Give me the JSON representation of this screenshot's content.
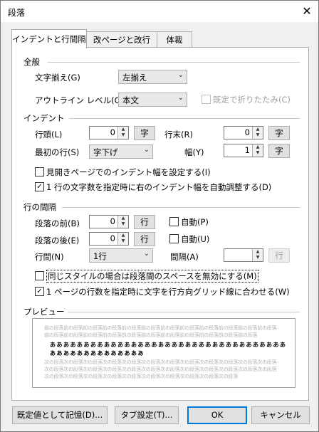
{
  "window": {
    "title": "段落",
    "close_glyph": "✕"
  },
  "tabs": [
    "インデントと行間隔",
    "改ページと改行",
    "体裁"
  ],
  "general": {
    "section": "全般",
    "align_label": "文字揃え(G)",
    "align_value": "左揃え",
    "outline_label": "アウトライン レベル(O)",
    "outline_value": "本文",
    "collapse_label": "既定で折りたたみ(C)"
  },
  "indent": {
    "section": "インデント",
    "left_label": "行頭(L)",
    "left_value": "0",
    "right_label": "行末(R)",
    "right_value": "0",
    "unit": "字",
    "first_label": "最初の行(S)",
    "first_value": "字下げ",
    "width_label": "幅(Y)",
    "width_value": "1",
    "mirror_label": "見開きページでのインデント幅を設定する(I)",
    "auto_adjust_label": "1 行の文字数を指定時に右のインデント幅を自動調整する(D)"
  },
  "spacing": {
    "section": "行の間隔",
    "before_label": "段落の前(B)",
    "before_value": "0",
    "after_label": "段落の後(E)",
    "after_value": "0",
    "unit": "行",
    "auto_before_label": "自動(P)",
    "auto_after_label": "自動(U)",
    "line_label": "行間(N)",
    "line_value": "1行",
    "at_label": "間隔(A)",
    "at_value": "",
    "no_space_label": "同じスタイルの場合は段落間のスペースを無効にする(M)",
    "snap_grid_label": "1 ページの行数を指定時に文字を行方向グリッド線に合わせる(W)"
  },
  "preview": {
    "section": "プレビュー",
    "prev_line1": "前の段落前の段落前の段落前の段落前の段落前の段落前の段落前の段落前の段落前の段落前の段落前の段落",
    "prev_line2": "前の段落前の段落前の段落前の段落前の段落前の段落前の段落前の段落前の段落前の段落前の段落",
    "sample_line1": "あああああああああああああああああああああああああああああああああああ",
    "sample_line2": "ああああああああああああああ",
    "next_line1": "次の段落次の段落次の段落次の段落次の段落次の段落次の段落次の段落次の段落次の段落次の段落次の段落",
    "next_line2": "次の段落次の段落次の段落次の段落次の段落次の段落次の段落次の段落次の段落次の段落次の段落次の段落",
    "next_line3": "次の段落次の段落次の段落次の段落次の段落次の段落次の段落次の段落次の段落次の段落"
  },
  "buttons": {
    "default": "既定値として記憶(D)...",
    "tabs": "タブ設定(T)...",
    "ok": "OK",
    "cancel": "キャンセル"
  },
  "checkbox_states": {
    "auto_adjust": true,
    "snap_grid": true,
    "mirror": false,
    "no_space": false,
    "auto_before": false,
    "auto_after": false,
    "collapse": false
  }
}
